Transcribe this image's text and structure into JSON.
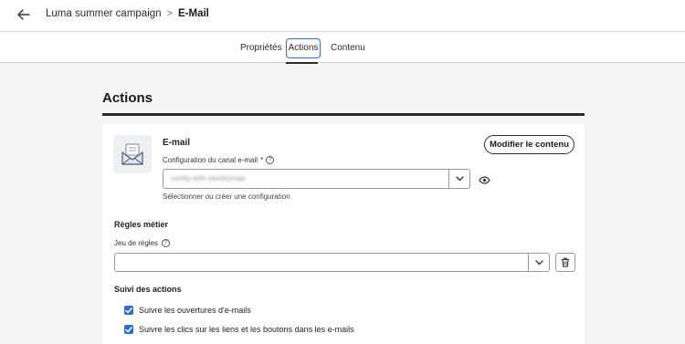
{
  "header": {
    "back_icon": "arrow-left-icon",
    "breadcrumb_parent": "Luma summer campaign",
    "breadcrumb_separator": ">",
    "breadcrumb_current": "E-Mail"
  },
  "tabs": [
    {
      "label": "Propriétés",
      "active": false
    },
    {
      "label": "Actions",
      "active": true
    },
    {
      "label": "Contenu",
      "active": false
    }
  ],
  "main": {
    "section_title": "Actions",
    "email": {
      "icon": "envelope-icon",
      "label": "E-mail",
      "modify_button": "Modifier le contenu",
      "config_label": "Configuration du canal e-mail",
      "required_mark": "*",
      "config_value": "config-with-identitymap",
      "config_hint": "Sélectionner ou créer une configuration"
    },
    "business_rules": {
      "heading": "Règles métier",
      "ruleset_label": "Jeu de règles",
      "ruleset_value": ""
    },
    "tracking": {
      "heading": "Suivi des actions",
      "options": [
        {
          "label": "Suivre les ouvertures d'e-mails",
          "checked": true
        },
        {
          "label": "Suivre les clics sur les liens et les boutons dans les e-mails",
          "checked": true
        }
      ]
    }
  },
  "colors": {
    "accent": "#2b6fd6",
    "background": "#f5f5f5",
    "card": "#ffffff",
    "text": "#222222"
  }
}
